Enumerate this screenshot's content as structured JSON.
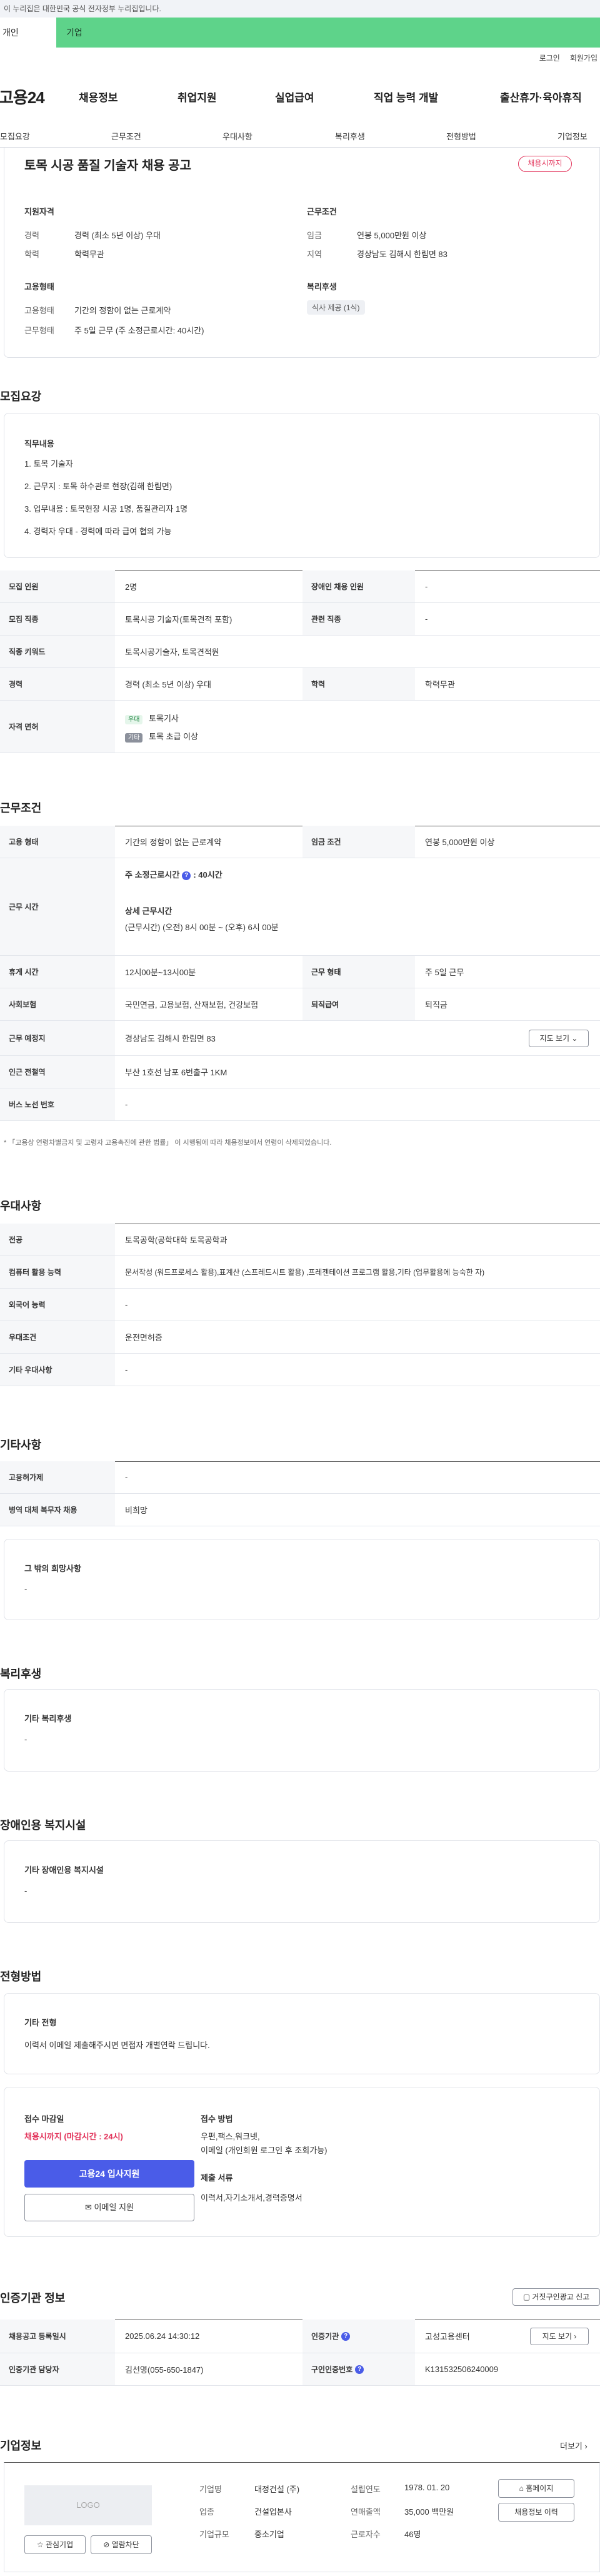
{
  "gov_banner": "이 누리집은 대한민국 공식 전자정부 누리집입니다.",
  "user_tabs": {
    "personal": "개인",
    "company": "기업"
  },
  "util_links": {
    "login": "로그인",
    "signup": "회원가입"
  },
  "gnb": {
    "logo": "고용24",
    "items": [
      "채용정보",
      "취업지원",
      "실업급여",
      "직업 능력 개발",
      "출산휴가·육아휴직"
    ]
  },
  "subnav": [
    "모집요강",
    "근무조건",
    "우대사항",
    "복리후생",
    "전형방법",
    "기업정보"
  ],
  "summary": {
    "title": "토목 시공 품질 기술자 채용 공고",
    "status": "채용시까지",
    "qual": {
      "heading": "지원자격",
      "career_key": "경력",
      "career_val": "경력 (최소 5년 이상) 우대",
      "edu_key": "학력",
      "edu_val": "학력무관"
    },
    "cond": {
      "heading": "근무조건",
      "wage_key": "임금",
      "wage_val": "연봉 5,000만원 이상",
      "loc_key": "지역",
      "loc_val": "경상남도 김해시 한림면 83"
    },
    "employ": {
      "heading": "고용형태",
      "type_key": "고용형태",
      "type_val": "기간의 정함이 없는 근로계약",
      "hours_key": "근무형태",
      "hours_val": "주 5일 근무 (주 소정근로시간: 40시간)"
    },
    "welfare": {
      "heading": "복리후생",
      "chip": "식사 제공 (1식)"
    }
  },
  "recruit": {
    "heading": "모집요강",
    "duty_title": "직무내용",
    "duties": [
      "1. 토목 기술자",
      "2. 근무지 : 토목 하수관로 현장(김해 한림면)",
      "3. 업무내용 : 토목현장 시공 1명, 품질관리자 1명",
      "4. 경력자 우대 - 경력에 따라 급여 협의 가능"
    ],
    "rows": [
      {
        "k1": "모집 인원",
        "v1": "2명",
        "k2": "장애인 채용 인원",
        "v2": "-"
      },
      {
        "k1": "모집 직종",
        "v1": "토목시공 기술자(토목견적 포함)",
        "k2": "관련 직종",
        "v2": "-"
      },
      {
        "k1": "직종 키워드",
        "v1": "토목시공기술자, 토목견적원"
      },
      {
        "k1": "경력",
        "v1": "경력 (최소 5년 이상) 우대",
        "k2": "학력",
        "v2": "학력무관"
      }
    ],
    "license_key": "자격 면허",
    "licenses": [
      {
        "tag": "우대",
        "name": "토목기사"
      },
      {
        "tag": "기타",
        "name": "토목 초급 이상"
      }
    ]
  },
  "conditions": {
    "heading": "근무조건",
    "emp_type_key": "고용 형태",
    "emp_type_val": "기간의 정함이 없는 근로계약",
    "wage_key": "임금 조건",
    "wage_val": "연봉 5,000만원 이상",
    "hours_key": "근무 시간",
    "hours_main": "주 소정근로시간",
    "hours_weekly": "40시간",
    "hours_detail_title": "상세 근무시간",
    "hours_detail": "(근무시간) (오전) 8시 00분 ~ (오후) 6시 00분",
    "rest_key": "휴게 시간",
    "rest_val": "12시00분~13시00분",
    "form_key": "근무 형태",
    "form_val": "주 5일 근무",
    "ins_key": "사회보험",
    "ins_val": "국민연금, 고용보험, 산재보험, 건강보험",
    "sev_key": "퇴직급여",
    "sev_val": "퇴직금",
    "place_key": "근무 예정지",
    "place_val": "경상남도 김해시 한림면 83",
    "map_btn": "지도 보기",
    "station_key": "인근 전철역",
    "station_val": "부산 1호선 남포 6번출구 1KM",
    "bus_key": "버스 노선 번호",
    "bus_val": "-",
    "note": "* 「고용상 연령차별금지 및 고령자 고용촉진에 관한 법률」 이 시행됨에 따라 채용정보에서 연령이 삭제되었습니다."
  },
  "preference": {
    "heading": "우대사항",
    "rows": [
      {
        "k": "전공",
        "v": "토목공학(공학대학 토목공학과"
      },
      {
        "k": "컴퓨터 활용 능력",
        "v": "문서작성 (워드프로세스 활용),표계산 (스프레드시트 활용) ,프레젠테이션 프로그램 활용,기타 (업무활용에 능숙한 자)"
      },
      {
        "k": "외국어 능력",
        "v": "-"
      },
      {
        "k": "우대조건",
        "v": "운전면허증"
      },
      {
        "k": "기타 우대사항",
        "v": "-"
      }
    ]
  },
  "etc": {
    "heading": "기타사항",
    "rows": [
      {
        "k": "고용허가제",
        "v": "-"
      },
      {
        "k": "병역 대체 복무자 채용",
        "v": "비희망"
      }
    ],
    "box_title": "그 밖의 희망사항",
    "box_val": "-"
  },
  "benefits": {
    "heading": "복리후생",
    "box_title": "기타 복리후생",
    "box_val": "-"
  },
  "disability": {
    "heading": "장애인용 복지시설",
    "box_title": "기타 장애인용 복지시설",
    "box_val": "-"
  },
  "process": {
    "heading": "전형방법",
    "box_title": "기타 전형",
    "box_val": "이력서 이메일 제출해주시면 면접자 개별연락 드립니다."
  },
  "apply": {
    "deadline_title": "접수 마감일",
    "deadline_val": "채용시까지 (마감시간 : 24시)",
    "apply_btn": "고용24 입사지원",
    "email_btn": "이메일 지원",
    "method_title": "접수 방법",
    "method_line1": "우편,팩스,워크넷,",
    "method_line2": "이메일 (개인회원 로그인 후 조회가능)",
    "docs_title": "제출 서류",
    "docs_val": "이력서,자기소개서,경력증명서"
  },
  "cert": {
    "heading": "인증기관 정보",
    "report_btn": "거짓구인광고 신고",
    "r1": {
      "k1": "채용공고 등록일시",
      "v1": "2025.06.24 14:30:12",
      "k2": "인증기관",
      "v2": "고성고용센터",
      "btn": "지도 보기"
    },
    "r2": {
      "k1": "인증기관 담당자",
      "v1": "김선영(055-650-1847)",
      "k2": "구인인증번호",
      "v2": "K131532506240009"
    }
  },
  "company": {
    "heading": "기업정보",
    "more": "더보기",
    "logo": "LOGO",
    "interest_btn": "관심기업",
    "block_btn": "열람차단",
    "name_key": "기업명",
    "name_val": "대정건설 (주)",
    "found_key": "설립연도",
    "found_val": "1978. 01. 20",
    "ind_key": "업종",
    "ind_val": "건설업본사",
    "sales_key": "연매출액",
    "sales_val": "35,000 백만원",
    "size_key": "기업규모",
    "size_val": "중소기업",
    "emp_key": "근로자수",
    "emp_val": "46명",
    "home_btn": "홈페이지",
    "hist_btn": "채용정보 이력"
  }
}
